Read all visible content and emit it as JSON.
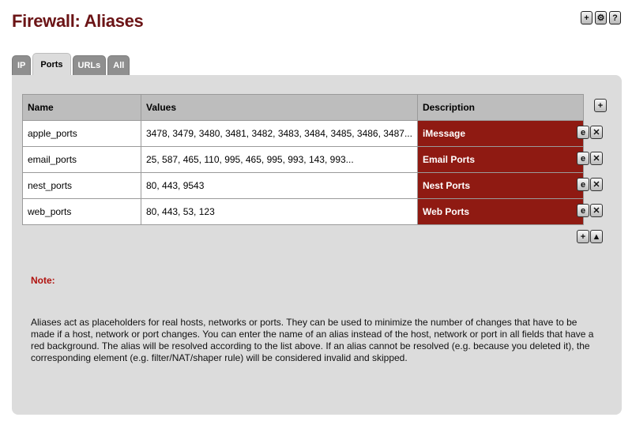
{
  "page": {
    "title": "Firewall: Aliases"
  },
  "header_icons": [
    {
      "name": "add-icon",
      "glyph": "+"
    },
    {
      "name": "settings-icon",
      "glyph": "⚙"
    },
    {
      "name": "help-icon",
      "glyph": "?"
    }
  ],
  "tabs": [
    {
      "label": "IP",
      "active": false
    },
    {
      "label": "Ports",
      "active": true
    },
    {
      "label": "URLs",
      "active": false
    },
    {
      "label": "All",
      "active": false
    }
  ],
  "table": {
    "headers": {
      "name": "Name",
      "values": "Values",
      "description": "Description"
    },
    "rows": [
      {
        "name": "apple_ports",
        "values": "3478, 3479, 3480, 3481, 3482, 3483, 3484, 3485, 3486, 3487...",
        "description": "iMessage"
      },
      {
        "name": "email_ports",
        "values": "25, 587, 465, 110, 995, 465, 995, 993, 143, 993...",
        "description": "Email Ports"
      },
      {
        "name": "nest_ports",
        "values": "80, 443, 9543",
        "description": "Nest Ports"
      },
      {
        "name": "web_ports",
        "values": "80, 443, 53, 123",
        "description": "Web Ports"
      }
    ]
  },
  "note": {
    "label": "Note:",
    "text": "Aliases act as placeholders for real hosts, networks or ports. They can be used to minimize the number of changes that have to be made if a host, network or port changes. You can enter the name of an alias instead of the host, network or port in all fields that have a red background. The alias will be resolved according to the list above. If an alias cannot be resolved (e.g. because you deleted it), the corresponding element (e.g. filter/NAT/shaper rule) will be considered invalid and skipped."
  },
  "colors": {
    "title": "#6b1416",
    "description_bg": "#8f1a12",
    "note_label": "#b0120e",
    "panel_bg": "#dcdcdc"
  }
}
